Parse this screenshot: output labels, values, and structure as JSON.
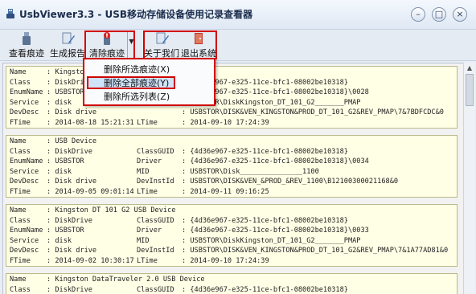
{
  "window": {
    "title": "UsbViewer3.3 - USB移动存储设备使用记录查看器"
  },
  "toolbar": {
    "view": "查看痕迹",
    "report": "生成报告",
    "clear": "清除痕迹",
    "about": "关于我们",
    "exit": "退出系统"
  },
  "menu": {
    "items": [
      "删除所选痕迹(X)",
      "删除全部痕迹(Y)",
      "删除所选列表(Z)"
    ],
    "highlighted_index": 1
  },
  "records": [
    {
      "rows": [
        [
          "Name",
          ": Kingston",
          "",
          ""
        ],
        [
          "Class",
          ": DiskDrive",
          "",
          ": {4d36e967-e325-11ce-bfc1-08002be10318}"
        ],
        [
          "EnumName",
          ": USBSTOR",
          "",
          ": {4d36e967-e325-11ce-bfc1-08002be10318}\\0028"
        ],
        [
          "Service",
          ": disk",
          "",
          ": USBSTOR\\DiskKingston_DT_101_G2_______PMAP"
        ],
        [
          "DevDesc",
          ": Disk drive",
          "",
          ": USBSTOR\\DISK&VEN_KINGSTON&PROD_DT_101_G2&REV_PMAP\\7&7BDFCDC&0"
        ],
        [
          "FTime",
          ": 2014-08-18 15:21:31",
          "LTime",
          ": 2014-09-10 17:24:39"
        ]
      ]
    },
    {
      "rows": [
        [
          "Name",
          ": USB Device",
          "",
          ""
        ],
        [
          "Class",
          ": DiskDrive",
          "ClassGUID",
          ": {4d36e967-e325-11ce-bfc1-08002be10318}"
        ],
        [
          "EnumName",
          ": USBSTOR",
          "Driver",
          ": {4d36e967-e325-11ce-bfc1-08002be10318}\\0034"
        ],
        [
          "Service",
          ": disk",
          "MID",
          ": USBSTOR\\Disk_______________1100"
        ],
        [
          "DevDesc",
          ": Disk drive",
          "DevInstId",
          ": USBSTOR\\DISK&VEN_&PROD_&REV_1100\\B12100300021168&0"
        ],
        [
          "FTime",
          ": 2014-09-05 09:01:14",
          "LTime",
          ": 2014-09-11 09:16:25"
        ]
      ]
    },
    {
      "rows": [
        [
          "Name",
          ": Kingston DT 101 G2 USB Device",
          "",
          ""
        ],
        [
          "Class",
          ": DiskDrive",
          "ClassGUID",
          ": {4d36e967-e325-11ce-bfc1-08002be10318}"
        ],
        [
          "EnumName",
          ": USBSTOR",
          "Driver",
          ": {4d36e967-e325-11ce-bfc1-08002be10318}\\0033"
        ],
        [
          "Service",
          ": disk",
          "MID",
          ": USBSTOR\\DiskKingston_DT_101_G2_______PMAP"
        ],
        [
          "DevDesc",
          ": Disk drive",
          "DevInstId",
          ": USBSTOR\\DISK&VEN_KINGSTON&PROD_DT_101_G2&REV_PMAP\\7&1A77AD81&0"
        ],
        [
          "FTime",
          ": 2014-09-02 10:30:17",
          "LTime",
          ": 2014-09-10 17:24:39"
        ]
      ]
    },
    {
      "rows": [
        [
          "Name",
          ": Kingston DataTraveler 2.0 USB Device",
          "",
          ""
        ],
        [
          "Class",
          ": DiskDrive",
          "ClassGUID",
          ": {4d36e967-e325-11ce-bfc1-08002be10318}"
        ]
      ]
    }
  ],
  "colors": {
    "record_bg": "#ffffe6",
    "highlight_border": "#d10000",
    "menu_highlight": "#cfe3fa"
  }
}
